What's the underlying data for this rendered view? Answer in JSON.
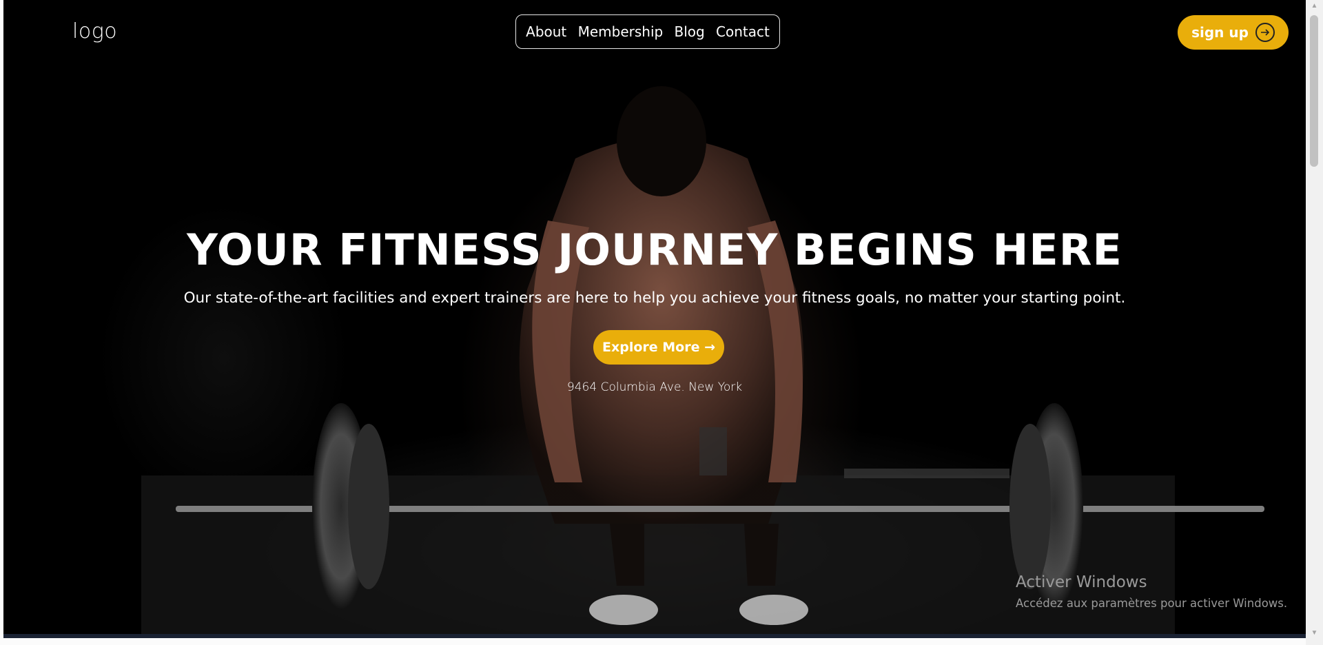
{
  "header": {
    "logo": "logo",
    "nav": [
      "About",
      "Membership",
      "Blog",
      "Contact"
    ],
    "signup_label": "sign up",
    "signup_icon": "arrow-right-circle-icon"
  },
  "hero": {
    "headline": "YOUR FITNESS JOURNEY BEGINS HERE",
    "subline": "Our state-of-the-art facilities and expert trainers are here to help you achieve your fitness goals, no matter your starting point.",
    "cta_label": "Explore More →",
    "address": "9464 Columbia Ave. New York"
  },
  "watermark": {
    "title": "Activer Windows",
    "subtitle": "Accédez aux paramètres pour activer Windows."
  },
  "colors": {
    "accent": "#e9ae0b",
    "background": "#000000",
    "text": "#ffffff"
  }
}
